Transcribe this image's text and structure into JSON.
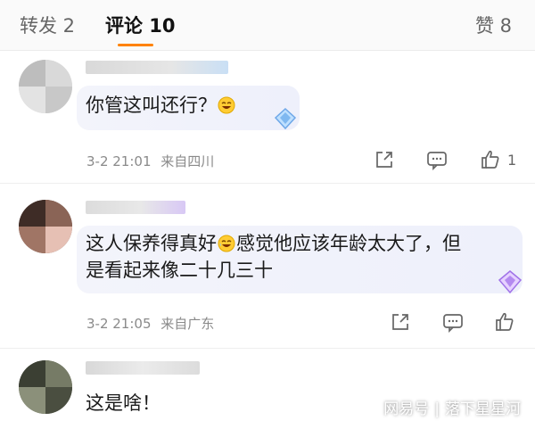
{
  "tabs": {
    "repost": "转发 2",
    "comments": "评论 10",
    "likes": "赞 8"
  },
  "comments": [
    {
      "text": [
        "你管这叫还行？"
      ],
      "time": "3-2 21:01",
      "location": "来自四川",
      "likes": "1"
    },
    {
      "text": [
        "这人保养得真好",
        "感觉他应该年龄太大了，但",
        "是看起来像二十几三十"
      ],
      "time": "3-2 21:05",
      "location": "来自广东",
      "likes": ""
    },
    {
      "text": [
        "这是啥！"
      ]
    }
  ],
  "watermark": {
    "source": "网易号",
    "author": "落下星星河"
  },
  "colors": {
    "accent": "#ff8200",
    "meta": "#8a8a8a",
    "bubble": "#eef0fb"
  }
}
